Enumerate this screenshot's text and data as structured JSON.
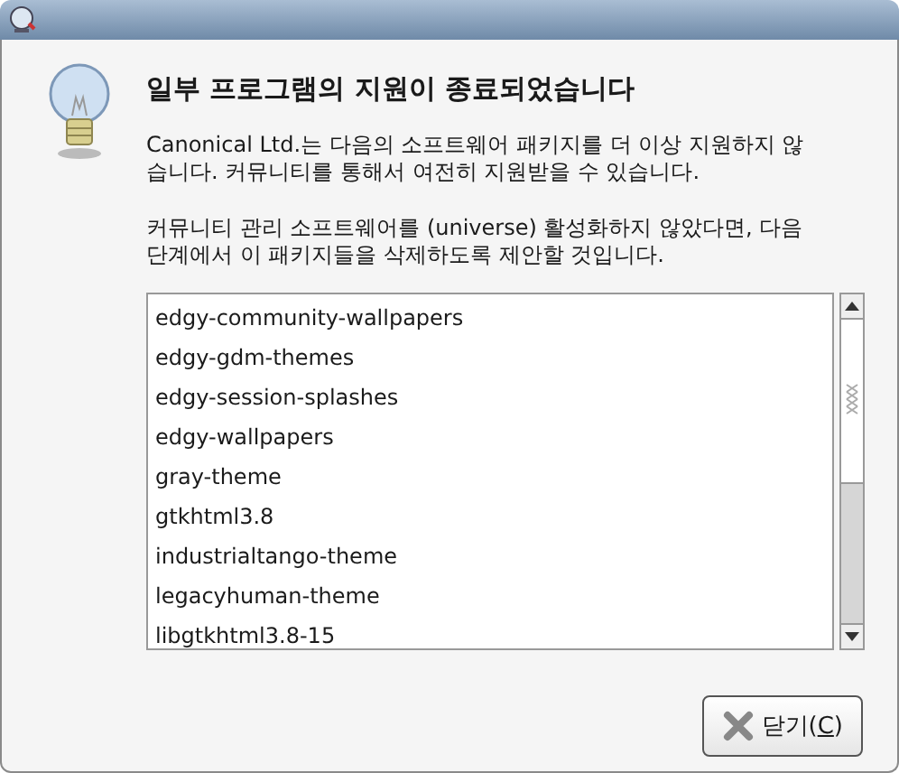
{
  "heading": "일부 프로그램의 지원이 종료되었습니다",
  "paragraphs": [
    "Canonical Ltd.는 다음의 소프트웨어 패키지를 더 이상 지원하지 않습니다. 커뮤니티를 통해서 여전히 지원받을 수 있습니다.",
    "커뮤니티 관리 소프트웨어를 (universe) 활성화하지 않았다면, 다음 단계에서 이 패키지들을 삭제하도록 제안할 것입니다."
  ],
  "packages": [
    "edgy-community-wallpapers",
    "edgy-gdm-themes",
    "edgy-session-splashes",
    "edgy-wallpapers",
    "gray-theme",
    "gtkhtml3.8",
    "industrialtango-theme",
    "legacyhuman-theme",
    "libgtkhtml3.8-15"
  ],
  "buttons": [
    {
      "label_before": "닫기(",
      "mnemonic": "C",
      "label_after": ")"
    }
  ]
}
